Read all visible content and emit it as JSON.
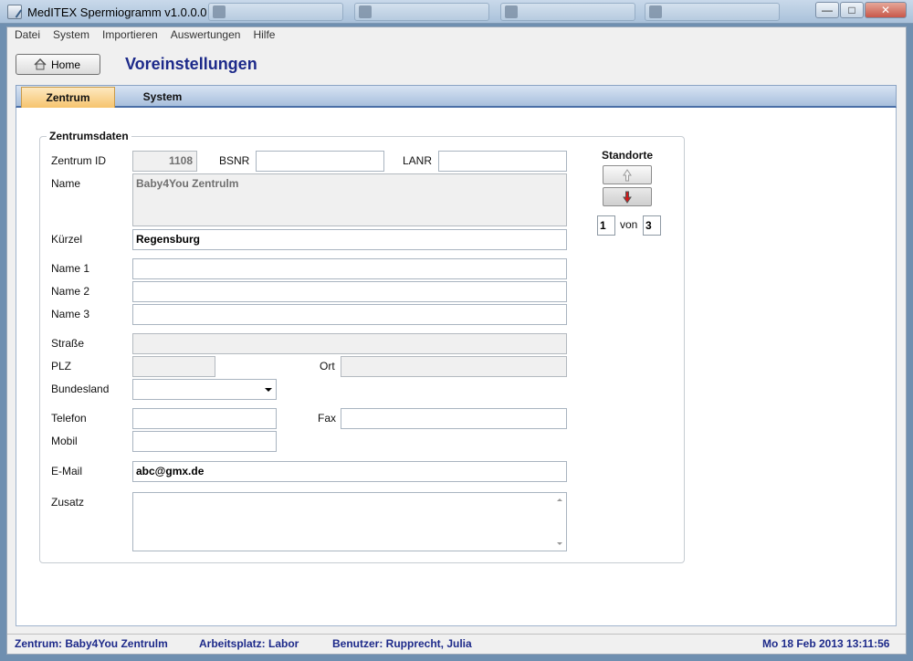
{
  "window": {
    "title": "MedITEX Spermiogramm v1.0.0.0",
    "taskbar_items": [
      "",
      "",
      "",
      ""
    ],
    "controls": {
      "minimize": "—",
      "maximize": "□",
      "close": "✕"
    }
  },
  "menu": [
    "Datei",
    "System",
    "Importieren",
    "Auswertungen",
    "Hilfe"
  ],
  "toolbar": {
    "home_label": "Home",
    "home_icon": "home-icon"
  },
  "page_title": "Voreinstellungen",
  "tabs": [
    {
      "label": "Zentrum",
      "active": true
    },
    {
      "label": "System",
      "active": false
    }
  ],
  "group_title": "Zentrumsdaten",
  "form": {
    "zentrum_id": {
      "label": "Zentrum ID",
      "value": "1108"
    },
    "bsnr": {
      "label": "BSNR",
      "value": ""
    },
    "lanr": {
      "label": "LANR",
      "value": ""
    },
    "name": {
      "label": "Name",
      "value": "Baby4You Zentrulm"
    },
    "kuerzel": {
      "label": "Kürzel",
      "value": "Regensburg"
    },
    "name1": {
      "label": "Name 1",
      "value": ""
    },
    "name2": {
      "label": "Name 2",
      "value": ""
    },
    "name3": {
      "label": "Name 3",
      "value": ""
    },
    "strasse": {
      "label": "Straße",
      "value": ""
    },
    "plz": {
      "label": "PLZ",
      "value": ""
    },
    "ort": {
      "label": "Ort",
      "value": ""
    },
    "bundesland": {
      "label": "Bundesland",
      "value": ""
    },
    "telefon": {
      "label": "Telefon",
      "value": ""
    },
    "fax": {
      "label": "Fax",
      "value": ""
    },
    "mobil": {
      "label": "Mobil",
      "value": ""
    },
    "email": {
      "label": "E-Mail",
      "value": "abc@gmx.de"
    },
    "zusatz": {
      "label": "Zusatz",
      "value": ""
    }
  },
  "standorte": {
    "title": "Standorte",
    "current": "1",
    "of_label": "von",
    "total": "3",
    "up_icon": "arrow-up-icon",
    "down_icon": "arrow-down-icon",
    "down_color": "#d11a1a"
  },
  "statusbar": {
    "zentrum": "Zentrum: Baby4You Zentrulm",
    "arbeitsplatz": "Arbeitsplatz: Labor",
    "benutzer": "Benutzer: Rupprecht, Julia",
    "datetime": "Mo 18 Feb 2013 13:11:56"
  },
  "colors": {
    "title_blue": "#1d2a8a",
    "tab_active": "#f6c46e"
  }
}
